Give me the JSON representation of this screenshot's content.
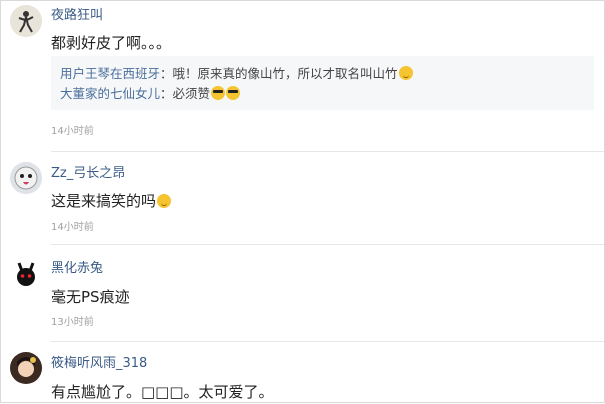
{
  "comments": [
    {
      "username": "夜路狂叫",
      "content": "都剥好皮了啊。。。",
      "time": "14小时前",
      "replies": [
        {
          "user": "用户王琴在西班牙",
          "sep": "：",
          "text": "哦！原来真的像山竹，所以才取名叫山竹",
          "emojis": [
            "smile-emoji"
          ]
        },
        {
          "user": "大董家的七仙女儿",
          "sep": "：",
          "text": "必须赞",
          "emojis": [
            "sunglasses-emoji",
            "sunglasses-emoji"
          ]
        }
      ]
    },
    {
      "username": "Zz_弓长之昂",
      "content": "这是来搞笑的吗",
      "time": "14小时前",
      "emoji": "grin-emoji"
    },
    {
      "username": "黑化赤兔",
      "content": "毫无PS痕迹",
      "time": "13小时前"
    },
    {
      "username": "筱梅听风雨_318",
      "content": "有点尴尬了。□□□。太可爱了。"
    }
  ]
}
